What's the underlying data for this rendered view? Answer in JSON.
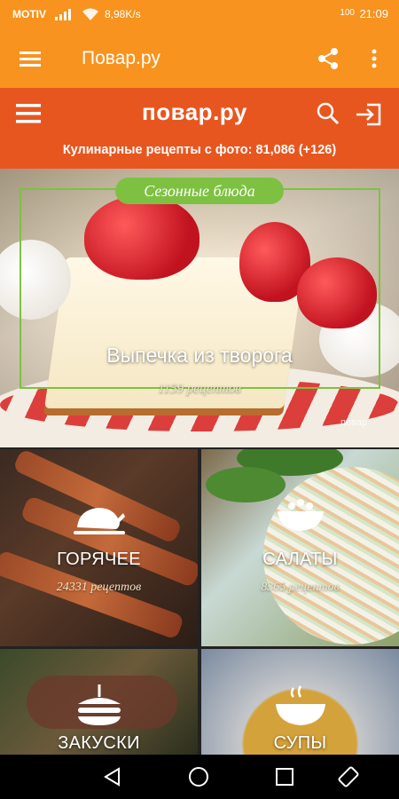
{
  "status_bar": {
    "carrier": "MOTIV",
    "signal_icon": "signal-icon",
    "wifi_icon": "wifi-icon",
    "speed": "8,98K/s",
    "battery": "100",
    "time": "21:09"
  },
  "app_bar": {
    "title": "Повар.ру",
    "menu_icon": "hamburger-menu-icon",
    "share_icon": "share-icon",
    "more_icon": "more-vertical-icon"
  },
  "site_header": {
    "logo": "повар.ру",
    "tagline": "Кулинарные рецепты с фото: 81,086 (+126)"
  },
  "hero": {
    "badge": "Сезонные блюда",
    "title": "Выпечка из творога",
    "count": "1159 рецептов",
    "watermark": "повар"
  },
  "categories": [
    {
      "name": "ГОРЯЧЕЕ",
      "count": "24331 рецептов",
      "icon": "roast-chicken-icon"
    },
    {
      "name": "САЛАТЫ",
      "count": "8365 рецептов",
      "icon": "salad-bowl-icon"
    },
    {
      "name": "ЗАКУСКИ",
      "count": "",
      "icon": "sandwich-icon"
    },
    {
      "name": "СУПЫ",
      "count": "",
      "icon": "soup-bowl-icon"
    }
  ],
  "nav_bar": [
    "back-icon",
    "home-icon",
    "recents-icon",
    "rotate-icon"
  ],
  "colors": {
    "app_bar": "#f7931e",
    "site_header": "#e8561f",
    "accent_green": "#7ec142"
  }
}
